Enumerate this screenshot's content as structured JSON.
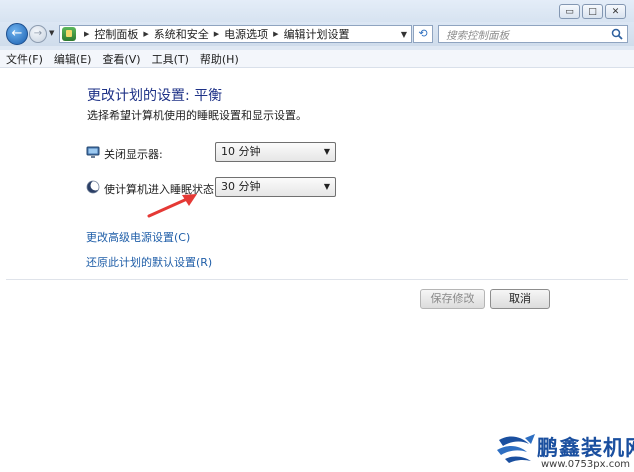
{
  "window": {
    "minimize_label": "▭",
    "maximize_label": "□",
    "close_label": "✕"
  },
  "address_bar": {
    "breadcrumbs": [
      "控制面板",
      "系统和安全",
      "电源选项",
      "编辑计划设置"
    ],
    "search_placeholder": "搜索控制面板"
  },
  "menu": {
    "items": [
      "文件(F)",
      "编辑(E)",
      "查看(V)",
      "工具(T)",
      "帮助(H)"
    ]
  },
  "main": {
    "title": "更改计划的设置: 平衡",
    "subtitle": "选择希望计算机使用的睡眠设置和显示设置。",
    "settings": [
      {
        "label": "关闭显示器:",
        "value": "10 分钟",
        "icon": "monitor-icon"
      },
      {
        "label": "使计算机进入睡眠状态:",
        "value": "30 分钟",
        "icon": "moon-icon"
      }
    ],
    "links": [
      "更改高级电源设置(C)",
      "还原此计划的默认设置(R)"
    ],
    "buttons": {
      "save": "保存修改",
      "cancel": "取消"
    }
  },
  "watermark": {
    "brand": "鹏鑫装机网",
    "url": "www.0753px.com"
  },
  "colors": {
    "title": "#1e3287",
    "link": "#1f5ea8",
    "arrow": "#e53935",
    "watermark": "#1a4f9f"
  }
}
